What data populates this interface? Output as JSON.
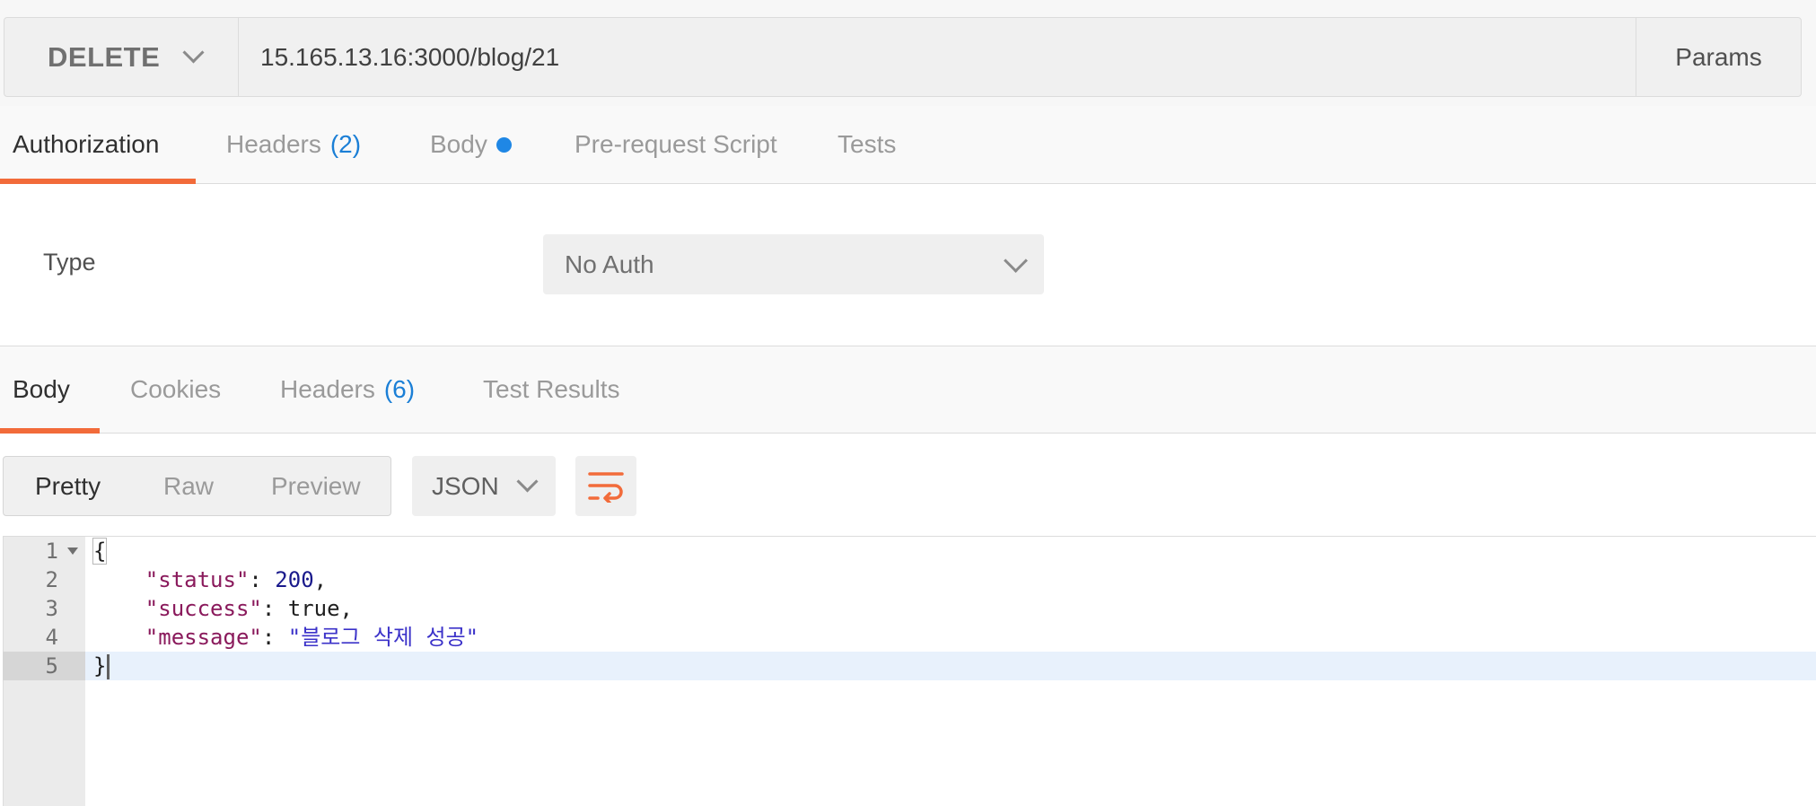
{
  "request": {
    "method": "DELETE",
    "url": "15.165.13.16:3000/blog/21",
    "params_label": "Params"
  },
  "request_tabs": [
    {
      "label": "Authorization",
      "active": true
    },
    {
      "label": "Headers",
      "count": "(2)"
    },
    {
      "label": "Body",
      "has_dot": true
    },
    {
      "label": "Pre-request Script"
    },
    {
      "label": "Tests"
    }
  ],
  "auth": {
    "type_label": "Type",
    "selected": "No Auth"
  },
  "response_tabs": [
    {
      "label": "Body",
      "active": true
    },
    {
      "label": "Cookies"
    },
    {
      "label": "Headers",
      "count": "(6)"
    },
    {
      "label": "Test Results"
    }
  ],
  "toolbar": {
    "views": [
      "Pretty",
      "Raw",
      "Preview"
    ],
    "active_view": "Pretty",
    "format": "JSON",
    "wrap_icon": "wrap-lines-icon"
  },
  "response_body": {
    "line_numbers": [
      "1",
      "2",
      "3",
      "4",
      "5"
    ],
    "open_brace": "{",
    "close_brace": "}",
    "fields": [
      {
        "key": "\"status\"",
        "value": "200",
        "type": "number"
      },
      {
        "key": "\"success\"",
        "value": "true",
        "type": "literal"
      },
      {
        "key": "\"message\"",
        "value": "\"블로그 삭제 성공\"",
        "type": "string"
      }
    ]
  },
  "colors": {
    "accent": "#f26b3a",
    "link_blue": "#1b7fd6",
    "json_key": "#8a1a5c",
    "json_number": "#1a1a8c",
    "json_string": "#3b32c9"
  }
}
